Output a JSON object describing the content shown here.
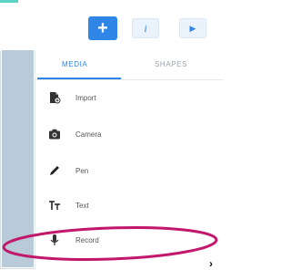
{
  "toolbar": {
    "add_glyph": "+",
    "info_glyph": "i",
    "play_glyph": "▶"
  },
  "tabs": [
    {
      "label": "MEDIA",
      "active": true
    },
    {
      "label": "SHAPES",
      "active": false
    }
  ],
  "menu": [
    {
      "label": "Import",
      "icon": "import-icon"
    },
    {
      "label": "Camera",
      "icon": "camera-icon"
    },
    {
      "label": "Pen",
      "icon": "pen-icon"
    },
    {
      "label": "Text",
      "icon": "text-icon"
    },
    {
      "label": "Record",
      "icon": "microphone-icon"
    }
  ],
  "scroll_glyph": "›",
  "colors": {
    "accent": "#2f86e6",
    "annotation": "#c2186b",
    "side_panel": "#b9cad9"
  }
}
